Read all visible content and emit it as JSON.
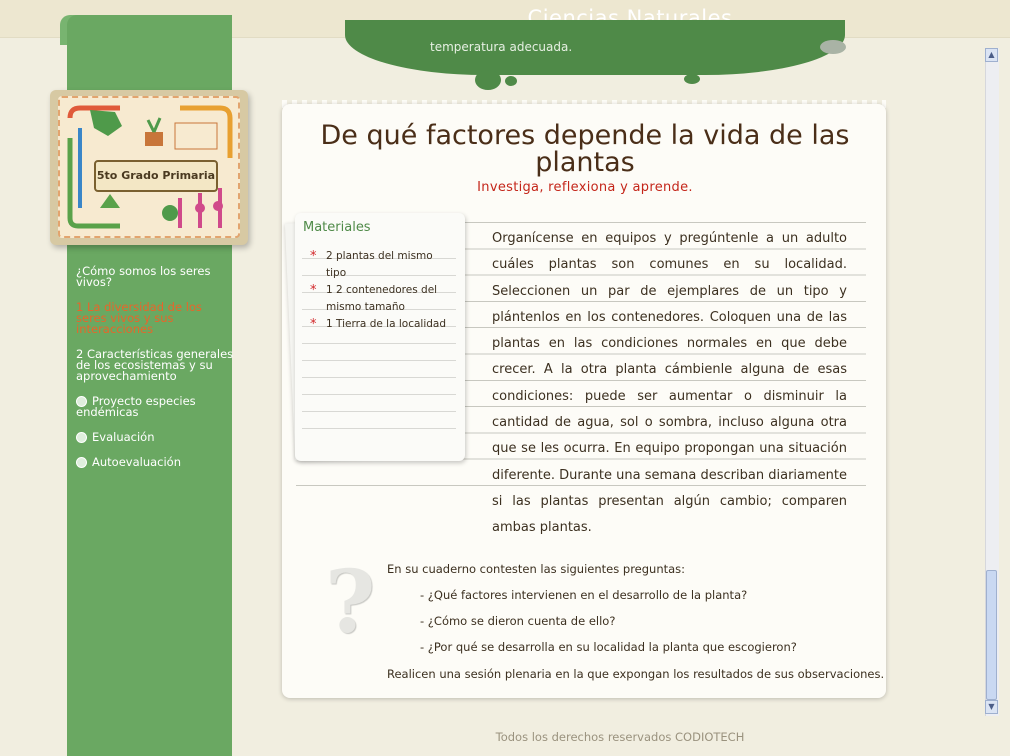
{
  "header": {
    "title": "Ciencias Naturales"
  },
  "cloud_text": "temperatura adecuada.",
  "sidebar": {
    "book_label": "5to Grado Primaria",
    "items": [
      {
        "label": "¿Cómo somos los seres vivos?",
        "active": false,
        "icon": ""
      },
      {
        "label": "1 La diversidad de los seres vivos y sus interacciones",
        "active": true,
        "icon": ""
      },
      {
        "label": "2 Características generales de los ecosistemas y su aprovechamiento",
        "active": false,
        "icon": ""
      },
      {
        "label": "Proyecto especies endémicas",
        "active": false,
        "icon": "bullet-icon"
      },
      {
        "label": "Evaluación",
        "active": false,
        "icon": "bullet-icon"
      },
      {
        "label": "Autoevaluación",
        "active": false,
        "icon": "bullet-icon"
      }
    ]
  },
  "main": {
    "title": "De qué factores depende la vida de las plantas",
    "subtitle": "Investiga, reflexiona y aprende.",
    "materials": {
      "title": "Materiales",
      "items": [
        "2 plantas del mismo tipo",
        "1 2 contenedores del mismo tamaño",
        "1 Tierra de la localidad"
      ]
    },
    "paragraph": "Organícense en equipos y pregúntenle a un adulto cuáles plantas son comunes en su localidad. Seleccionen un par de ejemplares de un tipo y plántenlos en los contenedores. Coloquen una de las plantas en las condiciones normales en que debe crecer. A la otra planta cámbienle alguna de esas condiciones: puede ser aumentar o disminuir la cantidad de agua, sol o sombra, incluso alguna otra que se les ocurra. En equipo propongan una situación diferente. Durante una semana describan diariamente si las plantas presentan algún cambio; comparen ambas plantas.",
    "questions": {
      "intro": "En su cuaderno contesten las siguientes preguntas:",
      "items": [
        "- ¿Qué factores intervienen en el desarrollo de la planta?",
        "- ¿Cómo se dieron cuenta de ello?",
        "- ¿Por qué se desarrolla en su localidad la planta que escogieron?"
      ],
      "outro": "Realicen una sesión plenaria en la que expongan los resultados de sus observaciones."
    }
  },
  "footer": {
    "text": "Todos los derechos reservados CODIOTECH"
  },
  "colors": {
    "sidebar": "#6aa862",
    "accent_red": "#c4261a",
    "title_brown": "#4a2e18"
  }
}
